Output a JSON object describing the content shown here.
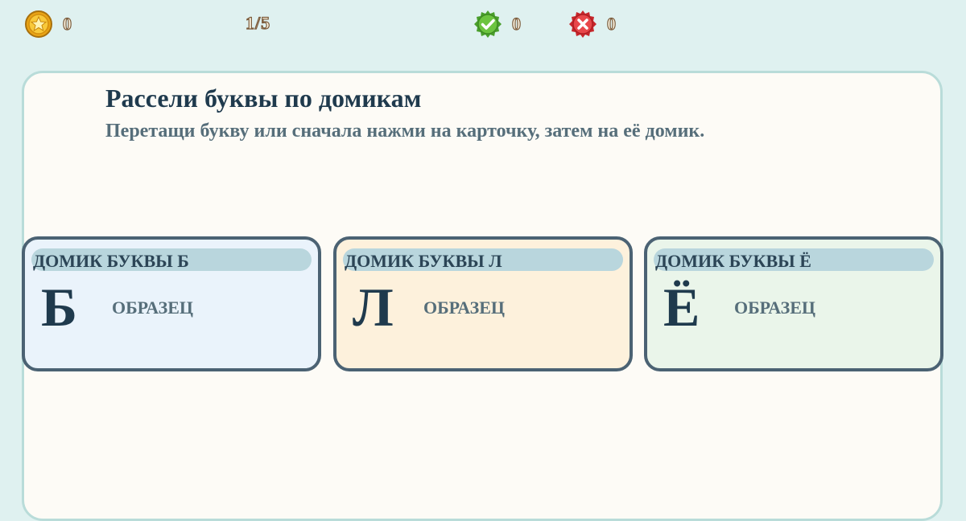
{
  "hud": {
    "coins": "0",
    "progress": "1/5",
    "correct": "0",
    "wrong": "0"
  },
  "task": {
    "title": "Рассели буквы по домикам",
    "instruction": "Перетащи букву или сначала нажми на карточку, затем на её домик."
  },
  "houses": [
    {
      "label": "ДОМИК БУКВЫ Б",
      "letter": "Б",
      "sample": "ОБРАЗЕЦ"
    },
    {
      "label": "ДОМИК БУКВЫ Л",
      "letter": "Л",
      "sample": "ОБРАЗЕЦ"
    },
    {
      "label": "ДОМИК БУКВЫ Ё",
      "letter": "Ё",
      "sample": "ОБРАЗЕЦ"
    }
  ],
  "colors": {
    "background": "#dff1f0",
    "panel": "#fdfbf6",
    "house_b": "#eaf3fb",
    "house_l": "#fdf1dc",
    "house_yo": "#eaf5ea",
    "coin": "#f2b624",
    "correct": "#5cb83a",
    "wrong": "#e0383c"
  },
  "icons": {
    "coins": "star-coin-icon",
    "correct": "check-badge-icon",
    "wrong": "cross-badge-icon"
  }
}
